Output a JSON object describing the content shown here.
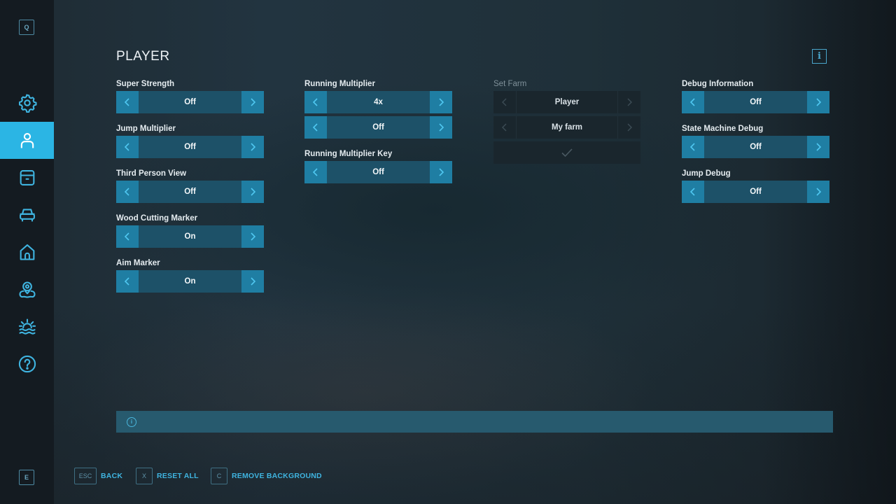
{
  "colors": {
    "accent": "#2bb5e4",
    "arrow_bg": "#1f7ea3",
    "value_bg": "#1d5168",
    "disabled_bg": "#1a262d",
    "sidebar_bg": "#141b21",
    "info_bar": "#275a6e"
  },
  "sidebar": {
    "top_key": "Q",
    "bottom_key": "E",
    "items": [
      {
        "icon": "gear-icon",
        "label": "Settings",
        "active": false
      },
      {
        "icon": "player-icon",
        "label": "Player",
        "active": true
      },
      {
        "icon": "archive-box-icon",
        "label": "Storage",
        "active": false
      },
      {
        "icon": "vehicle-icon",
        "label": "Vehicles",
        "active": false
      },
      {
        "icon": "house-icon",
        "label": "Farm",
        "active": false
      },
      {
        "icon": "map-pin-icon",
        "label": "Map",
        "active": false
      },
      {
        "icon": "weather-sunrise-icon",
        "label": "Environment",
        "active": false
      },
      {
        "icon": "help-icon",
        "label": "Help",
        "active": false
      }
    ]
  },
  "page": {
    "title": "PLAYER",
    "info_icon": "i"
  },
  "columns": [
    {
      "settings": [
        {
          "label": "Super Strength",
          "value": "Off"
        },
        {
          "label": "Jump Multiplier",
          "value": "Off"
        },
        {
          "label": "Third Person View",
          "value": "Off"
        },
        {
          "label": "Wood Cutting Marker",
          "value": "On"
        },
        {
          "label": "Aim Marker",
          "value": "On"
        }
      ]
    },
    {
      "settings": [
        {
          "label": "Running Multiplier",
          "value": "4x",
          "secondary_value": "Off"
        },
        {
          "label": "Running Multiplier Key",
          "value": "Off"
        }
      ]
    },
    {
      "settings": [
        {
          "label": "Set Farm",
          "value": "Player",
          "secondary_value": "My farm",
          "disabled": true,
          "confirm_icon": "checkmark-icon"
        }
      ]
    },
    {
      "settings": [
        {
          "label": "Debug Information",
          "value": "Off"
        },
        {
          "label": "State Machine Debug",
          "value": "Off"
        },
        {
          "label": "Jump Debug",
          "value": "Off"
        }
      ]
    }
  ],
  "info_bar": {
    "icon": "i",
    "text": ""
  },
  "footer": {
    "actions": [
      {
        "key": "ESC",
        "label": "BACK"
      },
      {
        "key": "X",
        "label": "RESET ALL"
      },
      {
        "key": "C",
        "label": "REMOVE BACKGROUND"
      }
    ]
  }
}
